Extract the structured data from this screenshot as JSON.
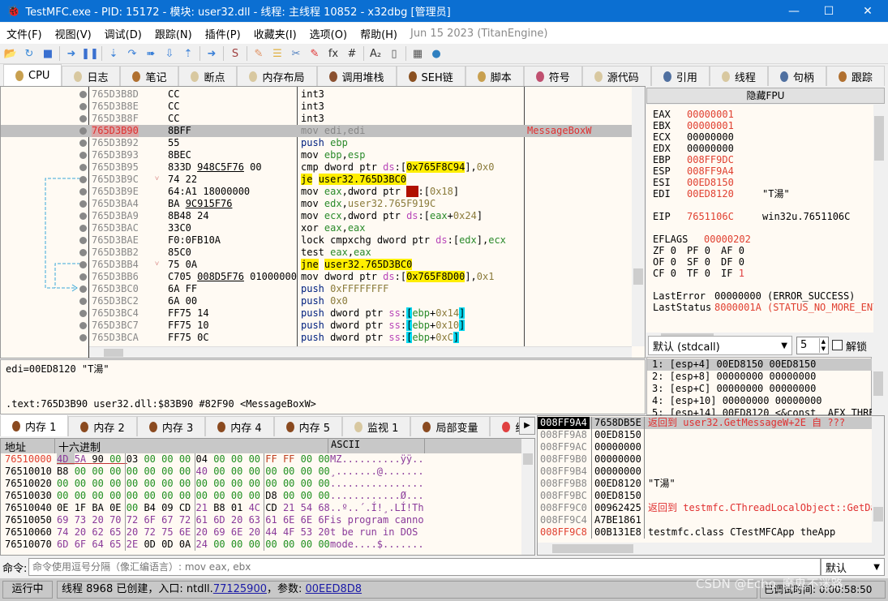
{
  "window": {
    "title": "TestMFC.exe - PID: 15172 - 模块: user32.dll - 线程: 主线程 10852 - x32dbg [管理员]",
    "minimize": "—",
    "maximize": "☐",
    "close": "✕"
  },
  "menu": {
    "items": [
      "文件(F)",
      "视图(V)",
      "调试(D)",
      "跟踪(N)",
      "插件(P)",
      "收藏夹(I)",
      "选项(O)",
      "帮助(H)"
    ],
    "version": "Jun 15 2023 (TitanEngine)"
  },
  "toolbar": {
    "icons": [
      "open-icon",
      "restart-icon",
      "stop-icon",
      "run-icon",
      "pause-icon",
      "step-into-icon",
      "step-over-icon",
      "trace-into-icon",
      "trace-over-icon",
      "execute-till-return-icon",
      "run-to-user-code-icon",
      "scylla-icon",
      "patch-icon",
      "comment-icon",
      "label-icon",
      "bookmark-icon",
      "function-icon",
      "hash-icon",
      "font-icon",
      "device-icon",
      "calculator-icon",
      "globe-icon"
    ]
  },
  "tabs": [
    {
      "label": "CPU",
      "color": "#c8a050"
    },
    {
      "label": "日志",
      "color": "#d8c8a0"
    },
    {
      "label": "笔记",
      "color": "#b07030"
    },
    {
      "label": "断点",
      "color": "#d8c8a0"
    },
    {
      "label": "内存布局",
      "color": "#d8c8a0"
    },
    {
      "label": "调用堆栈",
      "color": "#8a5030"
    },
    {
      "label": "SEH链",
      "color": "#8a5020"
    },
    {
      "label": "脚本",
      "color": "#c8a050"
    },
    {
      "label": "符号",
      "color": "#c05070"
    },
    {
      "label": "源代码",
      "color": "#d8c8a0"
    },
    {
      "label": "引用",
      "color": "#5070a0"
    },
    {
      "label": "线程",
      "color": "#d8c8a0"
    },
    {
      "label": "句柄",
      "color": "#5070a0"
    },
    {
      "label": "跟踪",
      "color": "#b07030"
    }
  ],
  "disasm": {
    "rows": [
      {
        "addr": "765D3B8D",
        "bytes": [
          [
            "CC",
            ""
          ]
        ],
        "ins": [
          [
            "int3",
            ""
          ]
        ],
        "comment": ""
      },
      {
        "addr": "765D3B8E",
        "bytes": [
          [
            "CC",
            ""
          ]
        ],
        "ins": [
          [
            "int3",
            ""
          ]
        ],
        "comment": ""
      },
      {
        "addr": "765D3B8F",
        "bytes": [
          [
            "CC",
            ""
          ]
        ],
        "ins": [
          [
            "int3",
            ""
          ]
        ],
        "comment": ""
      },
      {
        "addr": "765D3B90",
        "bytes": [
          [
            "8BFF",
            ""
          ]
        ],
        "ins": [
          [
            "mov edi,edi",
            "g"
          ]
        ],
        "comment": "MessageBoxW",
        "current": true
      },
      {
        "addr": "765D3B92",
        "bytes": [
          [
            "55",
            ""
          ]
        ],
        "ins": [
          [
            "push",
            "p"
          ],
          [
            " ",
            ""
          ],
          [
            "ebp",
            "r"
          ]
        ],
        "comment": ""
      },
      {
        "addr": "765D3B93",
        "bytes": [
          [
            "8BEC",
            ""
          ]
        ],
        "ins": [
          [
            "mov ",
            ""
          ],
          [
            "ebp",
            "r"
          ],
          [
            ",",
            ""
          ],
          [
            "esp",
            "r"
          ]
        ],
        "comment": ""
      },
      {
        "addr": "765D3B95",
        "bytes": [
          [
            "833D ",
            ""
          ],
          [
            "948C5F76",
            "u"
          ],
          [
            " 00",
            ""
          ]
        ],
        "ins": [
          [
            "cmp dword ptr ",
            ""
          ],
          [
            "ds",
            "s"
          ],
          [
            ":[",
            ""
          ],
          [
            "0x765F8C94",
            "yb"
          ],
          [
            "],",
            ""
          ],
          [
            "0x0",
            "n"
          ]
        ],
        "comment": ""
      },
      {
        "addr": "765D3B9C",
        "bytes": [
          [
            "74 22",
            ""
          ]
        ],
        "ins": [
          [
            "je",
            "yb"
          ],
          [
            " ",
            ""
          ],
          [
            "user32.765D3BC0",
            "yb"
          ]
        ],
        "comment": "",
        "fold": "˅"
      },
      {
        "addr": "765D3B9E",
        "bytes": [
          [
            "64:A1 18000000",
            ""
          ]
        ],
        "ins": [
          [
            "mov ",
            ""
          ],
          [
            "eax",
            "r"
          ],
          [
            ",dword ptr ",
            ""
          ],
          [
            "fs",
            "fb"
          ],
          [
            ":[",
            ""
          ],
          [
            "0x18",
            "n"
          ],
          [
            "]",
            ""
          ]
        ],
        "comment": ""
      },
      {
        "addr": "765D3BA4",
        "bytes": [
          [
            "BA ",
            ""
          ],
          [
            "9C915F76",
            "u"
          ]
        ],
        "ins": [
          [
            "mov ",
            ""
          ],
          [
            "edx",
            "r"
          ],
          [
            ",",
            ""
          ],
          [
            "user32.765F919C",
            "n"
          ]
        ],
        "comment": ""
      },
      {
        "addr": "765D3BA9",
        "bytes": [
          [
            "8B48 24",
            ""
          ]
        ],
        "ins": [
          [
            "mov ",
            ""
          ],
          [
            "ecx",
            "r"
          ],
          [
            ",dword ptr ",
            ""
          ],
          [
            "ds",
            "s"
          ],
          [
            ":[",
            ""
          ],
          [
            "eax",
            "r"
          ],
          [
            "+",
            ""
          ],
          [
            "0x24",
            "n"
          ],
          [
            "]",
            ""
          ]
        ],
        "comment": ""
      },
      {
        "addr": "765D3BAC",
        "bytes": [
          [
            "33C0",
            ""
          ]
        ],
        "ins": [
          [
            "xor ",
            ""
          ],
          [
            "eax",
            "r"
          ],
          [
            ",",
            ""
          ],
          [
            "eax",
            "r"
          ]
        ],
        "comment": ""
      },
      {
        "addr": "765D3BAE",
        "bytes": [
          [
            "F0:0FB10A",
            ""
          ]
        ],
        "ins": [
          [
            "lock cmpxchg dword ptr ",
            ""
          ],
          [
            "ds",
            "s"
          ],
          [
            ":[",
            ""
          ],
          [
            "edx",
            "r"
          ],
          [
            "],",
            ""
          ],
          [
            "ecx",
            "r"
          ]
        ],
        "comment": ""
      },
      {
        "addr": "765D3BB2",
        "bytes": [
          [
            "85C0",
            ""
          ]
        ],
        "ins": [
          [
            "test ",
            ""
          ],
          [
            "eax",
            "r"
          ],
          [
            ",",
            ""
          ],
          [
            "eax",
            "r"
          ]
        ],
        "comment": ""
      },
      {
        "addr": "765D3BB4",
        "bytes": [
          [
            "75 0A",
            ""
          ]
        ],
        "ins": [
          [
            "jne",
            "yb"
          ],
          [
            " ",
            ""
          ],
          [
            "user32.765D3BC0",
            "yb"
          ]
        ],
        "comment": "",
        "fold": "˅"
      },
      {
        "addr": "765D3BB6",
        "bytes": [
          [
            "C705 ",
            ""
          ],
          [
            "008D5F76",
            "u"
          ],
          [
            " 01000000",
            ""
          ]
        ],
        "ins": [
          [
            "mov dword ptr ",
            ""
          ],
          [
            "ds",
            "s"
          ],
          [
            ":[",
            ""
          ],
          [
            "0x765F8D00",
            "yb"
          ],
          [
            "],",
            ""
          ],
          [
            "0x1",
            "n"
          ]
        ],
        "comment": ""
      },
      {
        "addr": "765D3BC0",
        "bytes": [
          [
            "6A FF",
            ""
          ]
        ],
        "ins": [
          [
            "push",
            "p"
          ],
          [
            " ",
            ""
          ],
          [
            "0xFFFFFFFF",
            "n"
          ]
        ],
        "comment": ""
      },
      {
        "addr": "765D3BC2",
        "bytes": [
          [
            "6A 00",
            ""
          ]
        ],
        "ins": [
          [
            "push",
            "p"
          ],
          [
            " ",
            ""
          ],
          [
            "0x0",
            "n"
          ]
        ],
        "comment": ""
      },
      {
        "addr": "765D3BC4",
        "bytes": [
          [
            "FF75 14",
            ""
          ]
        ],
        "ins": [
          [
            "push",
            "p"
          ],
          [
            " dword ptr ",
            ""
          ],
          [
            "ss",
            "s"
          ],
          [
            ":",
            ""
          ],
          [
            "[",
            "cb"
          ],
          [
            "ebp",
            "r"
          ],
          [
            "+",
            ""
          ],
          [
            "0x14",
            "n"
          ],
          [
            "]",
            "cb"
          ]
        ],
        "comment": ""
      },
      {
        "addr": "765D3BC7",
        "bytes": [
          [
            "FF75 10",
            ""
          ]
        ],
        "ins": [
          [
            "push",
            "p"
          ],
          [
            " dword ptr ",
            ""
          ],
          [
            "ss",
            "s"
          ],
          [
            ":",
            ""
          ],
          [
            "[",
            "cb"
          ],
          [
            "ebp",
            "r"
          ],
          [
            "+",
            ""
          ],
          [
            "0x10",
            "n"
          ],
          [
            "]",
            "cb"
          ]
        ],
        "comment": ""
      },
      {
        "addr": "765D3BCA",
        "bytes": [
          [
            "FF75 0C",
            ""
          ]
        ],
        "ins": [
          [
            "push",
            "p"
          ],
          [
            " dword ptr ",
            ""
          ],
          [
            "ss",
            "s"
          ],
          [
            ":",
            ""
          ],
          [
            "[",
            "cb"
          ],
          [
            "ebp",
            "r"
          ],
          [
            "+",
            ""
          ],
          [
            "0xC",
            "n"
          ],
          [
            "]",
            "cb"
          ]
        ],
        "comment": ""
      }
    ]
  },
  "fpu_button": "隐藏FPU",
  "registers": [
    {
      "name": "EAX",
      "value": "00000001",
      "changed": true,
      "comment": ""
    },
    {
      "name": "EBX",
      "value": "00000001",
      "changed": true,
      "comment": ""
    },
    {
      "name": "ECX",
      "value": "00000000",
      "changed": false,
      "comment": ""
    },
    {
      "name": "EDX",
      "value": "00000000",
      "changed": false,
      "comment": ""
    },
    {
      "name": "EBP",
      "value": "008FF9DC",
      "changed": true,
      "comment": ""
    },
    {
      "name": "ESP",
      "value": "008FF9A4",
      "changed": true,
      "comment": ""
    },
    {
      "name": "ESI",
      "value": "00ED8150",
      "changed": true,
      "comment": ""
    },
    {
      "name": "EDI",
      "value": "00ED8120",
      "changed": true,
      "comment": "\"T湯\""
    },
    {
      "name": "",
      "value": "",
      "changed": false,
      "comment": ""
    },
    {
      "name": "EIP",
      "value": "7651106C",
      "changed": true,
      "comment": "win32u.7651106C"
    },
    {
      "name": "",
      "value": "",
      "changed": false,
      "comment": ""
    },
    {
      "name": "EFLAGS",
      "value": "00000202",
      "changed": true,
      "comment": ""
    }
  ],
  "flags": [
    [
      "ZF",
      "0"
    ],
    [
      "PF",
      "0"
    ],
    [
      "AF",
      "0"
    ],
    [
      "OF",
      "0"
    ],
    [
      "SF",
      "0"
    ],
    [
      "DF",
      "0"
    ],
    [
      "CF",
      "0"
    ],
    [
      "TF",
      "0"
    ],
    [
      "IF",
      "1"
    ]
  ],
  "last_error": {
    "label": "LastError",
    "value": "00000000 (ERROR_SUCCESS)"
  },
  "last_status": {
    "label": "LastStatus",
    "value": "8000001A (STATUS_NO_MORE_ENT"
  },
  "callconv": {
    "selected": "默认 (stdcall)",
    "count": "5",
    "unlock": "解锁"
  },
  "args": [
    "1: [esp+4] 00ED8150 00ED8150",
    "2: [esp+8] 00000000 00000000",
    "3: [esp+C] 00000000 00000000",
    "4: [esp+10] 00000000 00000000",
    "5: [esp+14] 00ED8120 <&const _AFX_THRE/"
  ],
  "info": {
    "line1": "edi=00ED8120 \"T湯\"",
    "line2": ".text:765D3B90 user32.dll:$83B90 #82F90 <MessageBoxW>"
  },
  "dump_tabs": [
    "内存 1",
    "内存 2",
    "内存 3",
    "内存 4",
    "内存 5",
    "监视 1",
    "局部变量",
    "结"
  ],
  "dump": {
    "headers": [
      "地址",
      "十六进制",
      "ASCII"
    ],
    "rows": [
      {
        "addr": "76510000",
        "hex": "4D 5A 90 00 03 00 00 00 04 00 00 00 FF FF 00 00",
        "ascii": "MZ..........ÿÿ.."
      },
      {
        "addr": "76510010",
        "hex": "B8 00 00 00 00 00 00 00 40 00 00 00 00 00 00 00",
        "ascii": "¸.......@......."
      },
      {
        "addr": "76510020",
        "hex": "00 00 00 00 00 00 00 00 00 00 00 00 00 00 00 00",
        "ascii": "................"
      },
      {
        "addr": "76510030",
        "hex": "00 00 00 00 00 00 00 00 00 00 00 00 D8 00 00 00",
        "ascii": "............Ø..."
      },
      {
        "addr": "76510040",
        "hex": "0E 1F BA 0E 00 B4 09 CD 21 B8 01 4C CD 21 54 68",
        "ascii": "..º..´.Í!¸.LÍ!Th"
      },
      {
        "addr": "76510050",
        "hex": "69 73 20 70 72 6F 67 72 61 6D 20 63 61 6E 6E 6F",
        "ascii": "is program canno"
      },
      {
        "addr": "76510060",
        "hex": "74 20 62 65 20 72 75 6E 20 69 6E 20 44 4F 53 20",
        "ascii": "t be run in DOS "
      },
      {
        "addr": "76510070",
        "hex": "6D 6F 64 65 2E 0D 0D 0A 24 00 00 00 00 00 00 00",
        "ascii": "mode....$......."
      }
    ]
  },
  "stack": {
    "rows": [
      {
        "addr": "008FF9A4",
        "value": "7658DB5E",
        "comment": "返回到 user32.GetMessageW+2E 自 ???",
        "type": "ret",
        "top": true
      },
      {
        "addr": "008FF9A8",
        "value": "00ED8150",
        "comment": ""
      },
      {
        "addr": "008FF9AC",
        "value": "00000000",
        "comment": ""
      },
      {
        "addr": "008FF9B0",
        "value": "00000000",
        "comment": ""
      },
      {
        "addr": "008FF9B4",
        "value": "00000000",
        "comment": ""
      },
      {
        "addr": "008FF9B8",
        "value": "00ED8120",
        "comment": "\"T湯\""
      },
      {
        "addr": "008FF9BC",
        "value": "00ED8150",
        "comment": ""
      },
      {
        "addr": "008FF9C0",
        "value": "00962425",
        "comment": "返回到 testmfc.CThreadLocalObject::GetDa",
        "type": "ret"
      },
      {
        "addr": "008FF9C4",
        "value": "A7BE1861",
        "comment": ""
      },
      {
        "addr": "008FF9C8",
        "value": "00B131E8",
        "comment": "testmfc.class CTestMFCApp theApp",
        "ebp": true
      }
    ]
  },
  "command": {
    "label": "命令:",
    "placeholder": "命令使用逗号分隔（像汇编语言）: mov eax, ebx",
    "mode": "默认"
  },
  "status": {
    "state": "运行中",
    "msg_prefix": "线程 8968 已创建，入口: ntdll.",
    "entry": "77125900",
    "msg_mid": "，参数: ",
    "param": "00EED8D8",
    "time": "已调试时间: 0:00:58:50",
    "watermark": "CSDN @Echo_魔鬼不迷路"
  }
}
